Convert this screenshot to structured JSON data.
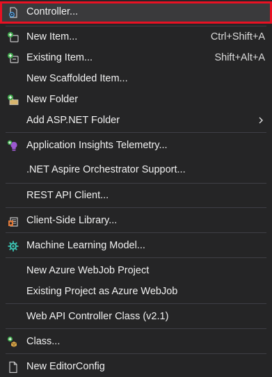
{
  "menu": {
    "items": [
      {
        "label": "Controller...",
        "shortcut": "",
        "icon": "controller-icon"
      },
      {
        "label": "New Item...",
        "shortcut": "Ctrl+Shift+A",
        "icon": "new-item-icon"
      },
      {
        "label": "Existing Item...",
        "shortcut": "Shift+Alt+A",
        "icon": "existing-item-icon"
      },
      {
        "label": "New Scaffolded Item...",
        "shortcut": "",
        "icon": ""
      },
      {
        "label": "New Folder",
        "shortcut": "",
        "icon": "new-folder-icon"
      },
      {
        "label": "Add ASP.NET Folder",
        "shortcut": "",
        "icon": "",
        "submenu": true
      },
      {
        "label": "Application Insights Telemetry...",
        "shortcut": "",
        "icon": "app-insights-icon"
      },
      {
        "label": ".NET Aspire Orchestrator Support...",
        "shortcut": "",
        "icon": ""
      },
      {
        "label": "REST API Client...",
        "shortcut": "",
        "icon": ""
      },
      {
        "label": "Client-Side Library...",
        "shortcut": "",
        "icon": "client-library-icon"
      },
      {
        "label": "Machine Learning Model...",
        "shortcut": "",
        "icon": "ml-model-icon"
      },
      {
        "label": "New Azure WebJob Project",
        "shortcut": "",
        "icon": ""
      },
      {
        "label": "Existing Project as Azure WebJob",
        "shortcut": "",
        "icon": ""
      },
      {
        "label": "Web API Controller Class (v2.1)",
        "shortcut": "",
        "icon": ""
      },
      {
        "label": "Class...",
        "shortcut": "",
        "icon": "add-class-icon"
      },
      {
        "label": "New EditorConfig",
        "shortcut": "",
        "icon": "file-icon"
      }
    ],
    "submenu_icon": "chevron-right-icon",
    "colors": {
      "background": "#252526",
      "highlight_border": "#e81123",
      "text": "#f1f1f1",
      "separator": "#3f3f46"
    }
  }
}
